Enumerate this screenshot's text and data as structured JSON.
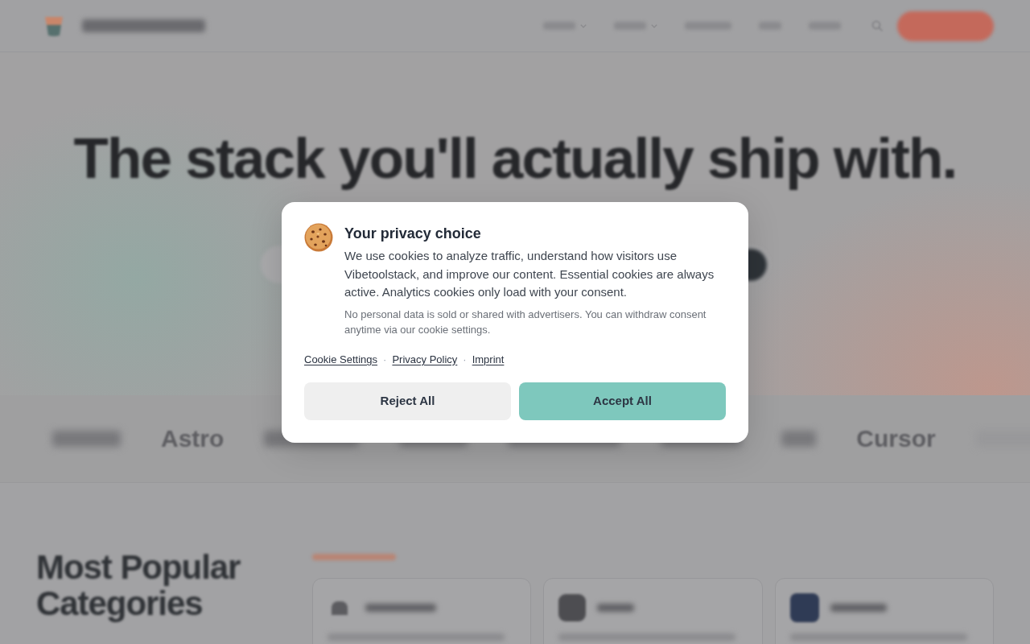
{
  "background_page": {
    "header": {
      "nav": [
        {
          "dropdown": true
        },
        {
          "dropdown": true
        },
        {
          "dropdown": false
        },
        {
          "dropdown": false
        },
        {
          "dropdown": false
        }
      ]
    },
    "hero": {
      "headline": "The stack you'll actually ship with."
    },
    "logo_strip": [
      {
        "kind": "blurred"
      },
      {
        "kind": "name",
        "label": "Astro"
      },
      {
        "kind": "blurred"
      },
      {
        "kind": "blurred"
      },
      {
        "kind": "blurred"
      },
      {
        "kind": "blurred"
      },
      {
        "kind": "blurred"
      },
      {
        "kind": "name",
        "label": "Cursor"
      },
      {
        "kind": "blurred"
      }
    ],
    "categories": {
      "heading": "Most Popular Categories"
    }
  },
  "cookie_dialog": {
    "title": "Your privacy choice",
    "body": "We use cookies to analyze traffic, understand how visitors use Vibetoolstack, and improve our content. Essential cookies are always active. Analytics cookies only load with your consent.",
    "note": "No personal data is sold or shared with advertisers. You can withdraw consent anytime via our cookie settings.",
    "links": [
      {
        "kind": "link",
        "label": "Cookie Settings"
      },
      {
        "kind": "separator",
        "label": "·"
      },
      {
        "kind": "link",
        "label": "Privacy Policy"
      },
      {
        "kind": "separator",
        "label": "·"
      },
      {
        "kind": "link",
        "label": "Imprint"
      }
    ],
    "buttons": [
      {
        "kind": "secondary",
        "label": "Reject All"
      },
      {
        "kind": "primary",
        "label": "Accept All"
      }
    ]
  }
}
